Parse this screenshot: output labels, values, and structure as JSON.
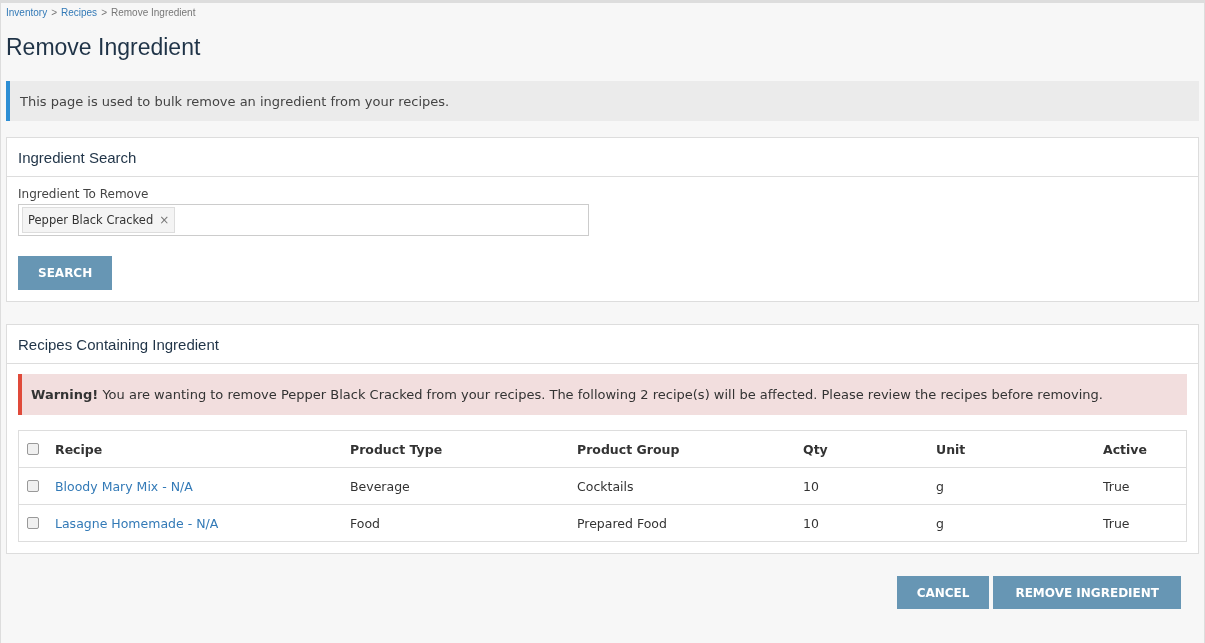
{
  "breadcrumb": [
    {
      "label": "Inventory",
      "link": true
    },
    {
      "label": "Recipes",
      "link": true
    },
    {
      "label": "Remove Ingredient",
      "link": false
    }
  ],
  "breadcrumb_separator": ">",
  "title": "Remove Ingredient",
  "info": "This page is used to bulk remove an ingredient from your recipes.",
  "search_panel": {
    "title": "Ingredient Search",
    "field_label": "Ingredient To Remove",
    "tags": [
      {
        "label": "Pepper Black Cracked",
        "remove": "×"
      }
    ],
    "button": "SEARCH"
  },
  "results_panel": {
    "title": "Recipes Containing Ingredient",
    "warning": "**Warning!** You are wanting to remove Pepper Black Cracked from your recipes. The following 2 recipe(s) will be affected. Please review the recipes before removing.",
    "select_all": {
      "checked": false
    },
    "columns": [
      "Recipe",
      "Product Type",
      "Product Group",
      "Qty",
      "Unit",
      "Active"
    ],
    "rows": [
      {
        "checked": false,
        "cells": [
          "Bloody Mary Mix - N/A",
          "Beverage",
          "Cocktails",
          "10",
          "g",
          "True"
        ]
      },
      {
        "checked": false,
        "cells": [
          "Lasagne Homemade - N/A",
          "Food",
          "Prepared Food",
          "10",
          "g",
          "True"
        ]
      }
    ]
  },
  "buttons": [
    "CANCEL",
    "REMOVE INGREDIENT"
  ]
}
